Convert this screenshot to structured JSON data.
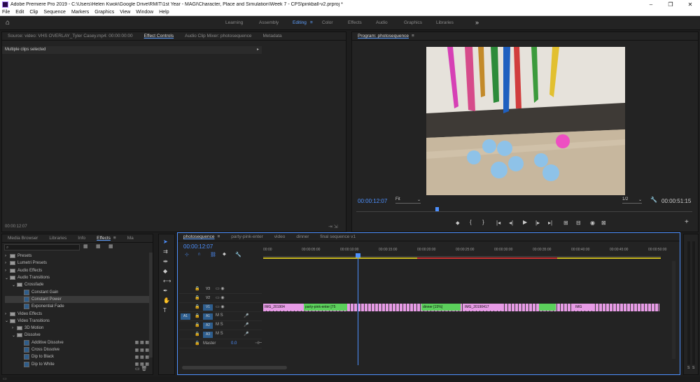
{
  "window": {
    "title": "Adobe Premiere Pro 2019 - C:\\Users\\Helen Kwok\\Google Drive\\RMIT\\1st Year - MAGI\\Character, Place and Simulation\\Week 7 - CPS\\pinkball-v2.prproj *",
    "minimize": "–",
    "maximize": "❐",
    "close": "✕"
  },
  "menu": [
    "File",
    "Edit",
    "Clip",
    "Sequence",
    "Markers",
    "Graphics",
    "View",
    "Window",
    "Help"
  ],
  "workspaces": [
    "Learning",
    "Assembly",
    "Editing",
    "Color",
    "Effects",
    "Audio",
    "Graphics",
    "Libraries"
  ],
  "workspace_active": "Editing",
  "source_panel": {
    "tabs": [
      "Source: video: VHS OVERLAY_Tyler Casey.mp4: 00:00:00:00",
      "Effect Controls",
      "Audio Clip Mixer: photosequence",
      "Metadata"
    ],
    "active_tab": "Effect Controls",
    "message": "Multiple clips selected",
    "timecode": "00:00:12:07"
  },
  "program_panel": {
    "tab": "Program: photosequence",
    "timecode": "00:00:12:07",
    "fit": "Fit",
    "resolution": "1/2",
    "duration": "00:00:51:15"
  },
  "effects_panel": {
    "tabs": [
      "Media Browser",
      "Libraries",
      "Info",
      "Effects",
      "Ma"
    ],
    "active_tab": "Effects",
    "tree": [
      {
        "label": "Presets",
        "depth": 0,
        "type": "folder",
        "open": false
      },
      {
        "label": "Lumetri Presets",
        "depth": 0,
        "type": "folder",
        "open": false
      },
      {
        "label": "Audio Effects",
        "depth": 0,
        "type": "folder",
        "open": false
      },
      {
        "label": "Audio Transitions",
        "depth": 0,
        "type": "folder",
        "open": true
      },
      {
        "label": "Crossfade",
        "depth": 1,
        "type": "folder",
        "open": true
      },
      {
        "label": "Constant Gain",
        "depth": 2,
        "type": "fx"
      },
      {
        "label": "Constant Power",
        "depth": 2,
        "type": "fx",
        "selected": true
      },
      {
        "label": "Exponential Fade",
        "depth": 2,
        "type": "fx"
      },
      {
        "label": "Video Effects",
        "depth": 0,
        "type": "folder",
        "open": false
      },
      {
        "label": "Video Transitions",
        "depth": 0,
        "type": "folder",
        "open": true
      },
      {
        "label": "3D Motion",
        "depth": 1,
        "type": "folder",
        "open": false
      },
      {
        "label": "Dissolve",
        "depth": 1,
        "type": "folder",
        "open": true
      },
      {
        "label": "Additive Dissolve",
        "depth": 2,
        "type": "fx"
      },
      {
        "label": "Cross Dissolve",
        "depth": 2,
        "type": "fx"
      },
      {
        "label": "Dip to Black",
        "depth": 2,
        "type": "fx"
      },
      {
        "label": "Dip to White",
        "depth": 2,
        "type": "fx"
      }
    ]
  },
  "timeline": {
    "tabs": [
      "photosequence",
      "party-pink-enter",
      "video",
      "dinner",
      "final sequence v1"
    ],
    "active_tab": "photosequence",
    "timecode": "00:00:12:07",
    "ruler": [
      "00:00",
      "00:00:05:00",
      "00:00:10:00",
      "00:00:15:00",
      "00:00:20:00",
      "00:00:25:00",
      "00:00:30:00",
      "00:00:35:00",
      "00:00:40:00",
      "00:00:45:00",
      "00:00:50:00"
    ],
    "tracks": [
      "V3",
      "V2",
      "V1",
      "A1",
      "A2",
      "A3"
    ],
    "master_label": "Master",
    "master_value": "0.0",
    "clips": [
      {
        "label": "IMG_201904",
        "color": "#e79be6"
      },
      {
        "label": "party-pink-enter [75",
        "color": "#5bd05b"
      },
      {
        "label": "dinner [15%]",
        "color": "#5bd05b"
      },
      {
        "label": "IMG_20190417",
        "color": "#e79be6"
      },
      {
        "label": "IMG",
        "color": "#e79be6"
      }
    ]
  },
  "audio_meter": {
    "labels": [
      "S",
      "S"
    ]
  }
}
